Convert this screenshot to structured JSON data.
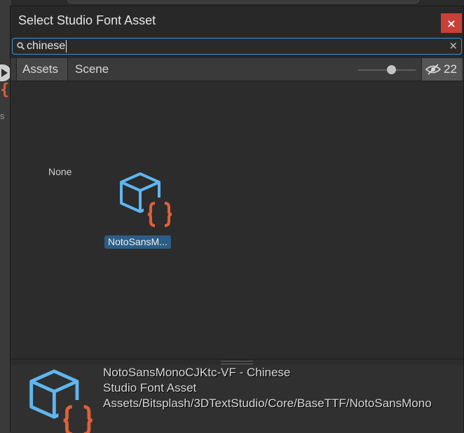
{
  "window": {
    "title": "Select Studio Font Asset",
    "close_glyph": "×"
  },
  "search": {
    "value": "chinese",
    "icon": "search-icon",
    "clear_glyph": "×"
  },
  "tabs": [
    {
      "label": "Assets",
      "active": true
    },
    {
      "label": "Scene",
      "active": false
    }
  ],
  "toolbar": {
    "zoom_slider_level": 0.58,
    "hidden_count": "22",
    "hidden_icon": "eye-slash-icon"
  },
  "grid": {
    "none_label": "None",
    "items": [
      {
        "label": "NotoSansM...",
        "icon": "font-asset-icon",
        "selected": true
      }
    ]
  },
  "preview": {
    "icon": "font-asset-icon",
    "name": "NotoSansMonoCJKtc-VF - Chinese",
    "type": "Studio Font Asset",
    "path": "Assets/Bitsplash/3DTextStudio/Core/BaseTTF/NotoSansMono"
  },
  "colors": {
    "accent": "#3d8fd6",
    "selection": "#2c5d87",
    "close": "#c8403a",
    "icon_cube": "#5fb6f0",
    "icon_brace": "#e0603a"
  }
}
